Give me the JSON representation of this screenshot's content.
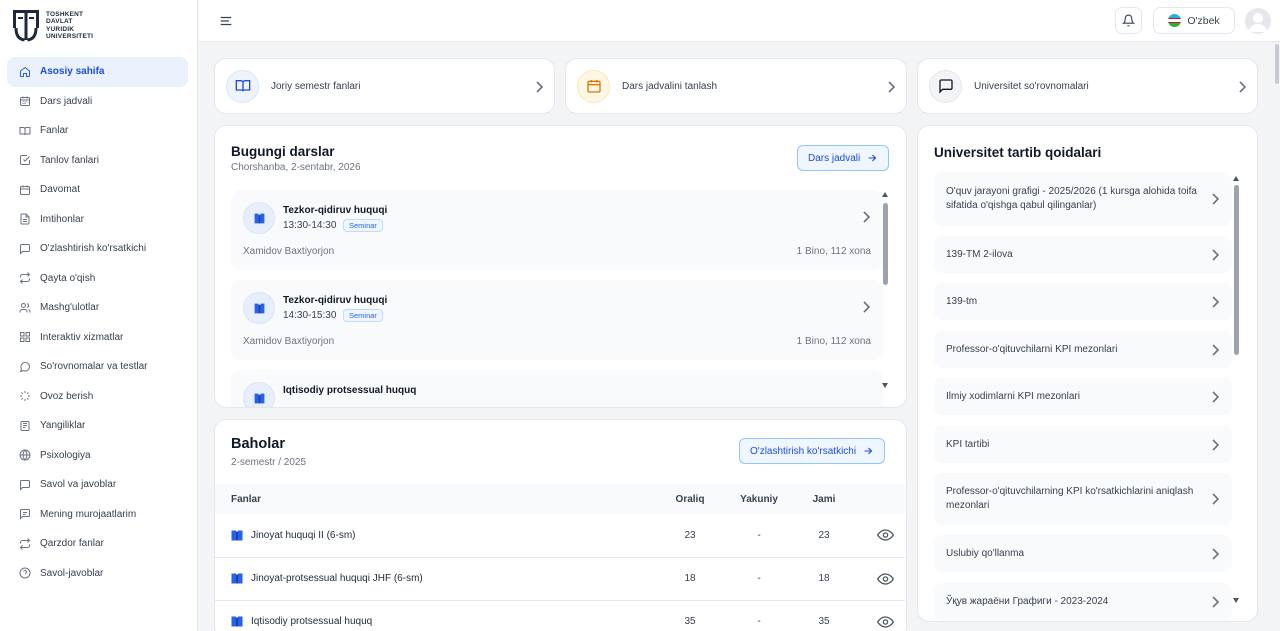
{
  "logo": {
    "lines": [
      "TOSHKENT",
      "DAVLAT",
      "YURIDIK",
      "UNIVERSITETI"
    ]
  },
  "sidebar": {
    "items": [
      {
        "label": "Asosiy sahifa",
        "icon": "home-icon",
        "active": true
      },
      {
        "label": "Dars jadvali",
        "icon": "calendar-icon"
      },
      {
        "label": "Fanlar",
        "icon": "book-icon"
      },
      {
        "label": "Tanlov fanlari",
        "icon": "check-square-icon"
      },
      {
        "label": "Davomat",
        "icon": "calendar-check-icon"
      },
      {
        "label": "Imtihonlar",
        "icon": "document-icon"
      },
      {
        "label": "O'zlashtirish ko'rsatkichi",
        "icon": "chat-icon"
      },
      {
        "label": "Qayta o'qish",
        "icon": "repeat-icon"
      },
      {
        "label": "Mashg'ulotlar",
        "icon": "users-icon"
      },
      {
        "label": "Interaktiv xizmatlar",
        "icon": "grid-icon"
      },
      {
        "label": "So'rovnomalar va testlar",
        "icon": "message-icon"
      },
      {
        "label": "Ovoz berish",
        "icon": "loader-icon"
      },
      {
        "label": "Yangiliklar",
        "icon": "news-icon"
      },
      {
        "label": "Psixologiya",
        "icon": "globe-icon"
      },
      {
        "label": "Savol va javoblar",
        "icon": "message-square-icon"
      },
      {
        "label": "Mening murojaatlarim",
        "icon": "message-text-icon"
      },
      {
        "label": "Qarzdor fanlar",
        "icon": "repeat-icon"
      },
      {
        "label": "Savol-javoblar",
        "icon": "help-circle-icon"
      }
    ]
  },
  "header": {
    "language": "O'zbek"
  },
  "quick_links": [
    {
      "label": "Joriy semestr fanlari",
      "icon": "open-book-icon"
    },
    {
      "label": "Dars jadvalini tanlash",
      "icon": "calendar-icon"
    },
    {
      "label": "Universitet so'rovnomalari",
      "icon": "message-icon"
    }
  ],
  "today": {
    "title": "Bugungi darslar",
    "date": "Chorshanba, 2-sentabr, 2026",
    "button": "Dars jadvali",
    "lessons": [
      {
        "name": "Tezkor-qidiruv huquqi",
        "time": "13:30-14:30",
        "type": "Seminar",
        "teacher": "Xamidov Baxtiyorjon",
        "room": "1 Bino, 112 xona"
      },
      {
        "name": "Tezkor-qidiruv huquqi",
        "time": "14:30-15:30",
        "type": "Seminar",
        "teacher": "Xamidov Baxtiyorjon",
        "room": "1 Bino, 112 xona"
      },
      {
        "name": "Iqtisodiy protsessual huquq"
      }
    ]
  },
  "grades": {
    "title": "Baholar",
    "semester": "2-semestr / 2025",
    "button": "O'zlashtirish ko'rsatkichi",
    "columns": [
      "Fanlar",
      "Oraliq",
      "Yakuniy",
      "Jami"
    ],
    "rows": [
      {
        "subject": "Jinoyat huquqi II (6-sm)",
        "oraliq": "23",
        "yakuniy": "-",
        "jami": "23"
      },
      {
        "subject": "Jinoyat-protsessual huquqi JHF (6-sm)",
        "oraliq": "18",
        "yakuniy": "-",
        "jami": "18"
      },
      {
        "subject": "Iqtisodiy protsessual huquq",
        "oraliq": "35",
        "yakuniy": "-",
        "jami": "35"
      }
    ]
  },
  "rules": {
    "title": "Universitet tartib qoidalari",
    "items": [
      "O'quv jarayoni grafigi - 2025/2026 (1 kursga alohida toifa sifatida o'qishga qabul qilinganlar)",
      "139-TM 2-ilova",
      "139-tm",
      "Professor-o'qituvchilarni KPI mezonlari",
      "Ilmiy xodimlarni KPI mezonlari",
      "KPI tartibi",
      "Professor-o'qituvchilarning KPI ko'rsatkichlarini aniqlash mezonlari",
      "Uslubiy qo'llanma",
      "Ўқув жараёни Графиги - 2023-2024"
    ]
  },
  "colors": {
    "accent": "#2563eb",
    "active_bg": "#eaf1fd",
    "page_bg": "#f3f4f6"
  }
}
